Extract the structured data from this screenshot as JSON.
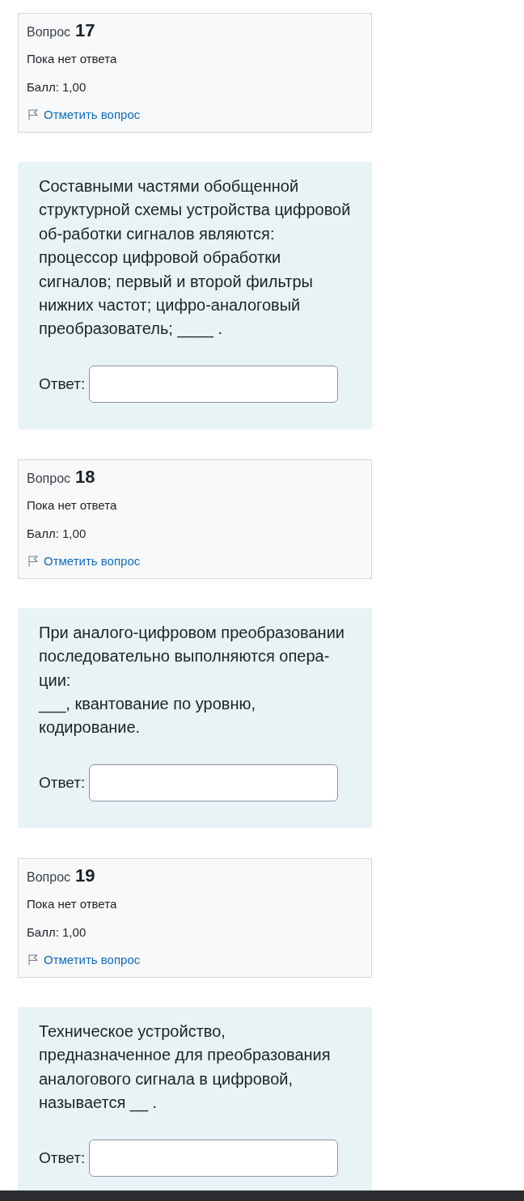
{
  "questions": [
    {
      "label": "Вопрос",
      "number": "17",
      "status": "Пока нет ответа",
      "mark": "Балл: 1,00",
      "flag_link": "Отметить вопрос",
      "text": "Составными частями обобщенной структурной схемы устройства цифровой об-работки сигналов являются: процессор цифровой обработки сигналов; первый и второй фильтры нижних частот; цифро-аналоговый преобразователь; ____ .",
      "answer_label": "Ответ:"
    },
    {
      "label": "Вопрос",
      "number": "18",
      "status": "Пока нет ответа",
      "mark": "Балл: 1,00",
      "flag_link": "Отметить вопрос",
      "text": "При аналого-цифровом преобразовании последовательно выполняются опера-ции:\n___, квантование по уровню, кодирование.",
      "answer_label": "Ответ:"
    },
    {
      "label": "Вопрос",
      "number": "19",
      "status": "Пока нет ответа",
      "mark": "Балл: 1,00",
      "flag_link": "Отметить вопрос",
      "text": "Техническое устройство, предназначенное для преобразования аналогового сигнала в цифровой, называется __ .",
      "answer_label": "Ответ:"
    }
  ]
}
